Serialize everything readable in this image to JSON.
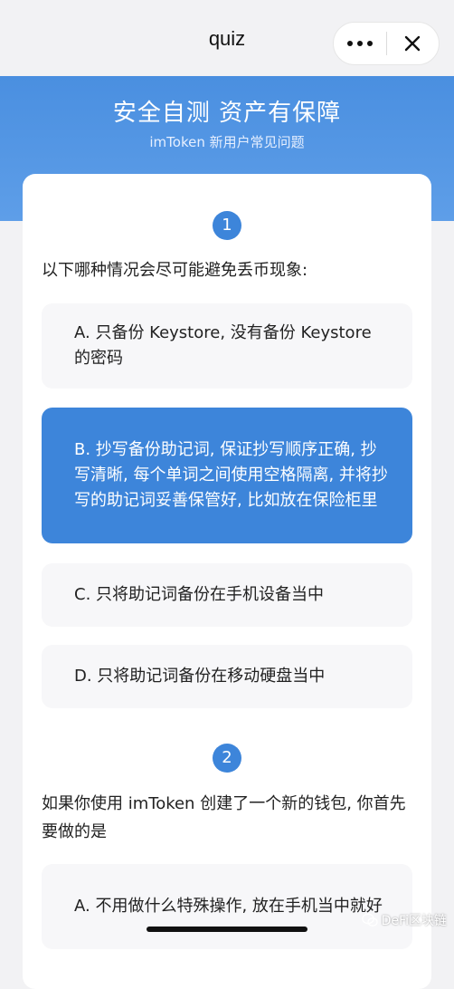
{
  "nav": {
    "title": "quiz",
    "more_icon": "more-dots-icon",
    "close_icon": "close-icon"
  },
  "banner": {
    "title": "安全自测 资产有保障",
    "subtitle": "imToken 新用户常见问题",
    "color": "#4a8fe0"
  },
  "questions": [
    {
      "number": "1",
      "text": "以下哪种情况会尽可能避免丢币现象:",
      "options": [
        {
          "label": "A. 只备份 Keystore, 没有备份 Keystore 的密码",
          "selected": false
        },
        {
          "label": "B. 抄写备份助记词, 保证抄写顺序正确, 抄写清晰, 每个单词之间使用空格隔离, 并将抄写的助记词妥善保管好, 比如放在保险柜里",
          "selected": true
        },
        {
          "label": "C. 只将助记词备份在手机设备当中",
          "selected": false
        },
        {
          "label": "D. 只将助记词备份在移动硬盘当中",
          "selected": false
        }
      ]
    },
    {
      "number": "2",
      "text": "如果你使用 imToken 创建了一个新的钱包, 你首先要做的是",
      "options": [
        {
          "label": "A. 不用做什么特殊操作, 放在手机当中就好",
          "selected": false
        }
      ]
    }
  ],
  "watermark": {
    "text": "DeFi区块链",
    "icon": "wechat-icon"
  },
  "colors": {
    "accent": "#3d85da",
    "option_bg": "#f7f7f9"
  }
}
